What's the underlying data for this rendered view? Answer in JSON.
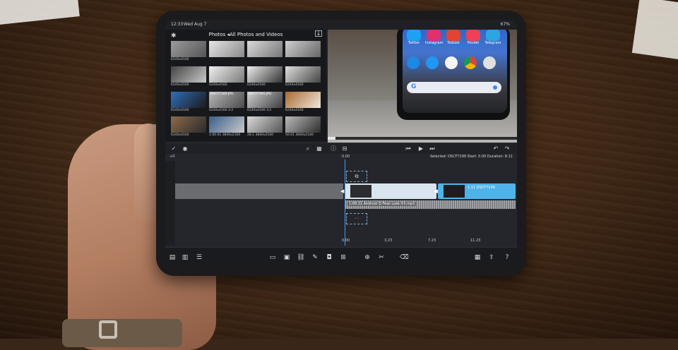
{
  "status": {
    "time": "12:33",
    "date": "Wed Aug 7",
    "battery": "67%"
  },
  "browser": {
    "title": "Photos ◂All Photos and Videos",
    "thumbs": [
      {
        "name": "",
        "dims": "6240x4160"
      },
      {
        "name": "",
        "dims": ""
      },
      {
        "name": "",
        "dims": ""
      },
      {
        "name": "",
        "dims": ""
      },
      {
        "name": "",
        "dims": "6240x4160"
      },
      {
        "name": "",
        "dims": "6240x4160"
      },
      {
        "name": "",
        "dims": "6240x4160"
      },
      {
        "name": "",
        "dims": "6240x4160"
      },
      {
        "name": "",
        "dims": "6240x4160"
      },
      {
        "name": "DSCF7189.JPG",
        "dims": "6240x4160  3:2"
      },
      {
        "name": "DSCF7191.JPG",
        "dims": "6240x4160  3:2"
      },
      {
        "name": "",
        "dims": "6240x4160"
      },
      {
        "name": "",
        "dims": "6240x4160"
      },
      {
        "name": "",
        "dims": "1:00.01  3840x2160"
      },
      {
        "name": "",
        "dims": "28.1  3840x2160"
      },
      {
        "name": "",
        "dims": "50.01  3840x2160"
      }
    ]
  },
  "viewer": {
    "apps": [
      "Twitter",
      "Instagram",
      "Todoist",
      "Pocket",
      "Telegram"
    ],
    "playback_fraction": 0.04
  },
  "timeline": {
    "start": "+0",
    "playhead": "0.00",
    "selected": "Selected: DSCF7199 Start: 0.00 Duration: 8.11",
    "clip1_label": "",
    "clip2_label": "1.11  DSCF7199",
    "audio_label": "1:09.11  Android Q Final Look.V3.mp3",
    "codes": [
      "0.00",
      "3.23",
      "7.23",
      "11.23"
    ]
  }
}
